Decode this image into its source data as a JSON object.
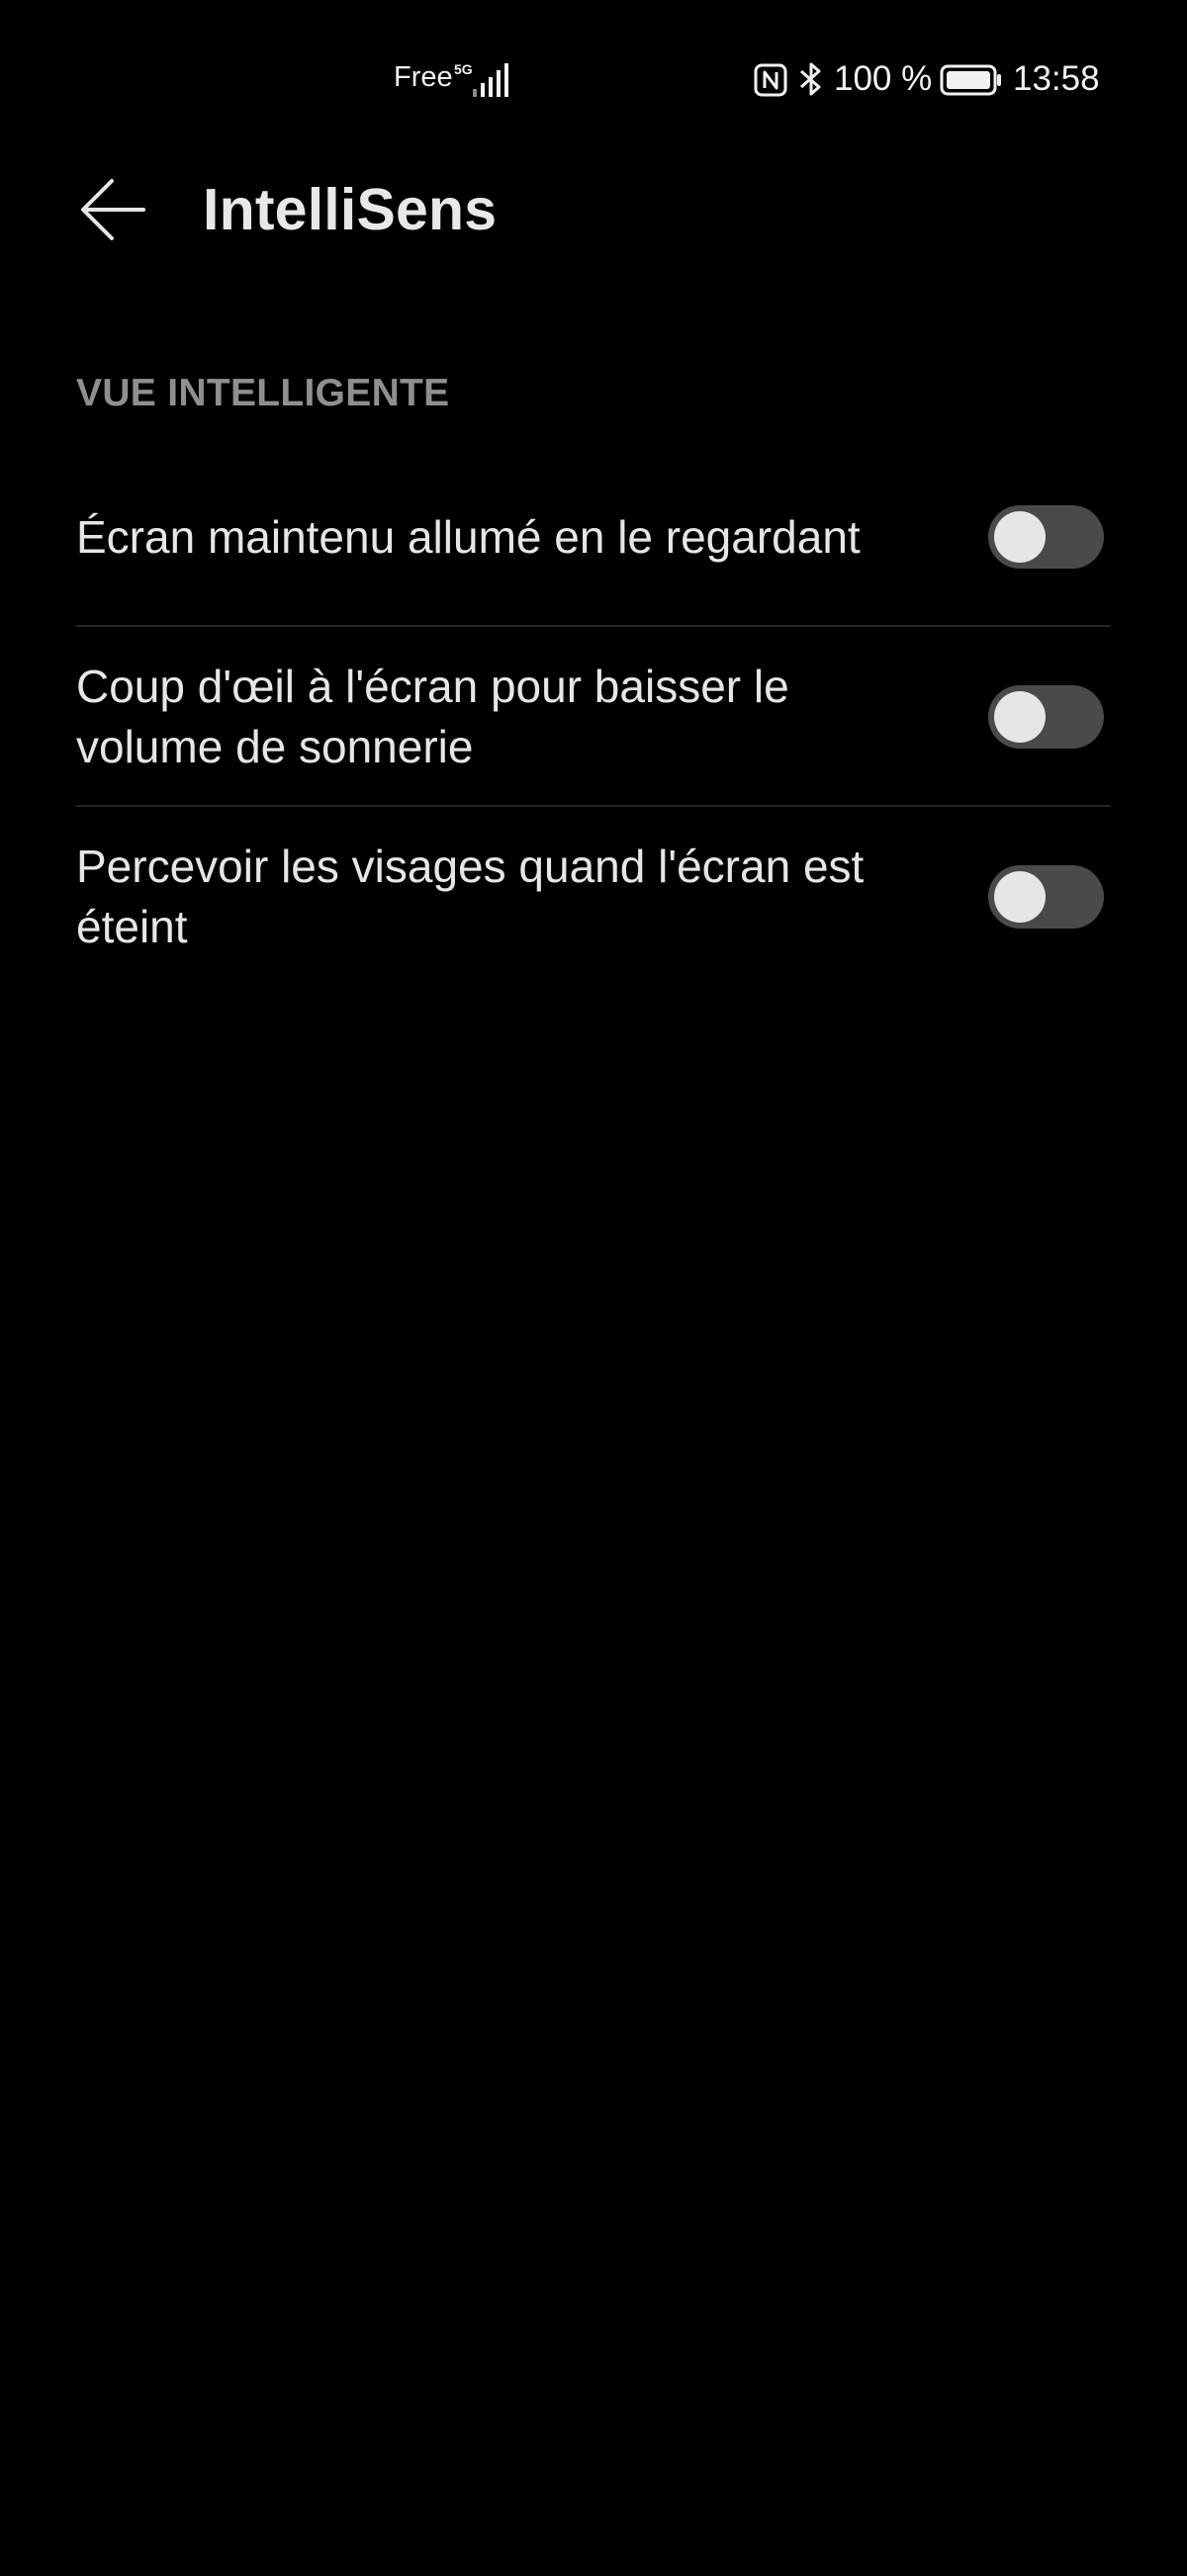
{
  "status_bar": {
    "carrier": "Free",
    "network_type": "5G",
    "battery_percent": "100 %",
    "time": "13:58",
    "icons": [
      "signal-icon",
      "nfc-icon",
      "bluetooth-icon",
      "battery-icon"
    ]
  },
  "header": {
    "back_icon": "arrow-left-icon",
    "title": "IntelliSens"
  },
  "section": {
    "title": "VUE INTELLIGENTE",
    "items": [
      {
        "label": "Écran maintenu allumé en le regardant",
        "enabled": false
      },
      {
        "label": "Coup d'œil à l'écran pour baisser le volume de sonnerie",
        "enabled": false
      },
      {
        "label": "Percevoir les visages quand l'écran est éteint",
        "enabled": false
      }
    ]
  },
  "colors": {
    "background": "#000000",
    "text_primary": "#e6e6e6",
    "text_secondary": "#8f8f8f",
    "toggle_off_track": "#4a4a4a",
    "toggle_knob": "#e6e6e6",
    "divider": "#262626"
  }
}
